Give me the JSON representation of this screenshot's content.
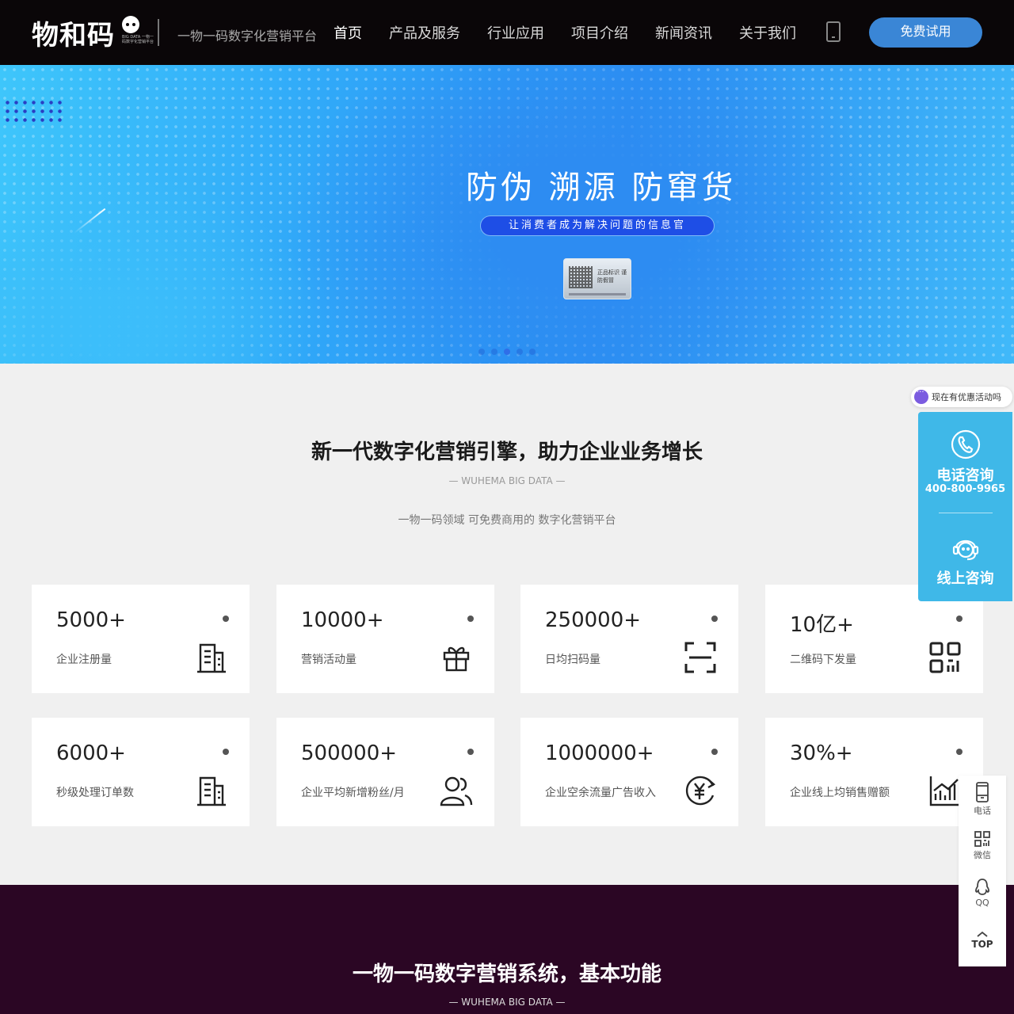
{
  "header": {
    "logo_text": "物和码",
    "logo_sub": "BIG DATA 一物一码数字化营销平台",
    "slogan": "一物一码数字化营销平台",
    "nav": [
      {
        "label": "首页",
        "active": true
      },
      {
        "label": "产品及服务",
        "active": false
      },
      {
        "label": "行业应用",
        "active": false
      },
      {
        "label": "项目介绍",
        "active": false
      },
      {
        "label": "新闻资讯",
        "active": false
      },
      {
        "label": "关于我们",
        "active": false
      }
    ],
    "trial_button": "免费试用"
  },
  "banner": {
    "title": "防伪 溯源 防窜货",
    "pill": "让消费者成为解决问题的信息官",
    "label_text": "正品标识 谨防假冒",
    "dots_count": 5,
    "active_dot": 2
  },
  "intro": {
    "title": "新一代数字化营销引擎，助力企业业务增长",
    "subtitle": "— WUHEMA BIG DATA —",
    "description": "一物一码领域 可免费商用的 数字化营销平台"
  },
  "stats": [
    {
      "value": "5000+",
      "label": "企业注册量",
      "icon": "building-icon"
    },
    {
      "value": "10000+",
      "label": "营销活动量",
      "icon": "gift-icon"
    },
    {
      "value": "250000+",
      "label": "日均扫码量",
      "icon": "scan-icon"
    },
    {
      "value": "10亿+",
      "label": "二维码下发量",
      "icon": "qrcode-icon"
    },
    {
      "value": "6000+",
      "label": "秒级处理订单数",
      "icon": "building-icon"
    },
    {
      "value": "500000+",
      "label": "企业平均新增粉丝/月",
      "icon": "users-icon"
    },
    {
      "value": "1000000+",
      "label": "企业空余流量广告收入",
      "icon": "yuan-icon"
    },
    {
      "value": "30%+",
      "label": "企业线上均销售赠额",
      "icon": "chart-icon"
    }
  ],
  "side": {
    "promo": "现在有优惠活动吗",
    "phone_title": "电话咨询",
    "phone_number": "400-800-9965",
    "online_title": "线上咨询"
  },
  "toolbar": {
    "phone": "电话",
    "wechat": "微信",
    "qq": "QQ",
    "top": "TOP"
  },
  "section2": {
    "title": "一物一码数字营销系统，基本功能",
    "subtitle": "— WUHEMA BIG DATA —"
  },
  "colors": {
    "header_bg": "#0a0608",
    "accent": "#3a86d6",
    "consult_bg": "#3fb8e8",
    "purple_bg": "#2b0624"
  }
}
